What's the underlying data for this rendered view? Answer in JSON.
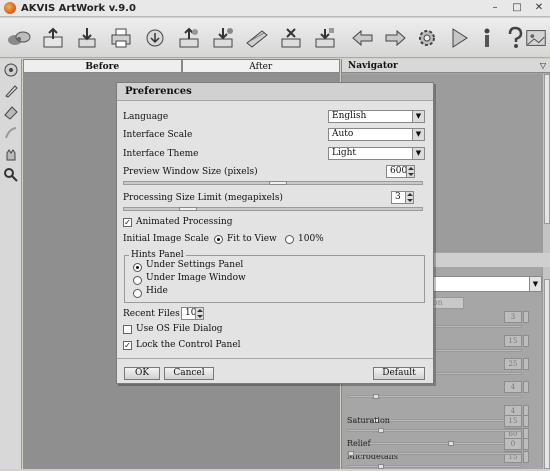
{
  "window": {
    "title": "AKVIS ArtWork v.9.0",
    "minimize": "–",
    "maximize": "□",
    "close": "✕"
  },
  "toolbar": {
    "icons": [
      "paint-mix-icon",
      "open-image-icon",
      "save-image-icon",
      "print-icon",
      "share-icon",
      "batch-icon",
      "export-icon",
      "ribbon-icon",
      "compare-icon",
      "plugin-icon",
      "undo-icon",
      "redo-icon",
      "settings-icon",
      "run-icon",
      "info-icon",
      "help-icon",
      "gallery-icon"
    ]
  },
  "canvas": {
    "tab_before": "Before",
    "tab_after": "After"
  },
  "navigator": {
    "title": "Navigator",
    "tab_partial": "tion"
  },
  "right_params": [
    {
      "label": "",
      "value": "3"
    },
    {
      "label": "",
      "value": "15"
    },
    {
      "label": "",
      "value": "25"
    },
    {
      "label": "",
      "value": "4"
    },
    {
      "label": "",
      "value": "4"
    },
    {
      "label": "",
      "value": "60"
    },
    {
      "label": "Microdetails",
      "value": "15"
    },
    {
      "label": "Saturation",
      "value": "15"
    },
    {
      "label": "Relief",
      "value": "0"
    }
  ],
  "dialog": {
    "title": "Preferences",
    "language_label": "Language",
    "language_value": "English",
    "scale_label": "Interface Scale",
    "scale_value": "Auto",
    "theme_label": "Interface Theme",
    "theme_value": "Light",
    "preview_label": "Preview Window Size (pixels)",
    "preview_value": "600",
    "limit_label": "Processing Size Limit (megapixels)",
    "limit_value": "3",
    "animated_label": "Animated Processing",
    "animated_checked": true,
    "initial_scale_label": "Initial Image Scale",
    "fit_label": "Fit to View",
    "pct_label": "100%",
    "hints_title": "Hints Panel",
    "hint_under_settings": "Under Settings Panel",
    "hint_under_image": "Under Image Window",
    "hint_hide": "Hide",
    "recent_label": "Recent Files",
    "recent_value": "10",
    "os_dialog_label": "Use OS File Dialog",
    "os_dialog_checked": false,
    "lock_label": "Lock the Control Panel",
    "lock_checked": true,
    "ok": "OK",
    "cancel": "Cancel",
    "default": "Default"
  }
}
